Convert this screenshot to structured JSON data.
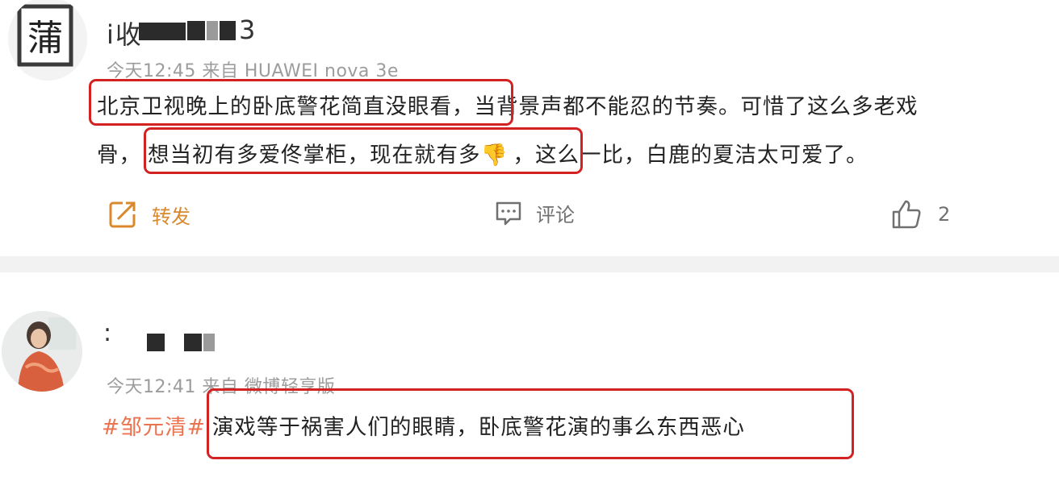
{
  "post1": {
    "avatar_char": "蒲",
    "username_visible": "i收",
    "username_tail": "3",
    "meta": "今天12:45  来自 HUAWEI nova 3e",
    "line1_highlight": "北京卫视晚上的卧底警花简直没眼看",
    "line1_rest": "，当背景声都不能忍的节奏。可惜了这么多老戏",
    "line2_start": "骨，",
    "line2_highlight": "想当初有多爱佟掌柜，现在就有多👎",
    "line2_rest": "，这么一比，白鹿的夏洁太可爱了。",
    "actions": {
      "repost_label": "转发",
      "comment_label": "评论",
      "like_count": "2"
    }
  },
  "post2": {
    "username_visible": ":",
    "meta": "今天12:41  来自 微博轻享版",
    "topic": "#邹元清#",
    "body_highlight": "演戏等于祸害人们的眼睛，卧底警花演的事么东西恶心"
  },
  "colors": {
    "highlight_border": "#d32222",
    "topic": "#eb7350",
    "repost": "#d9892b",
    "meta": "#9c9c9c"
  },
  "icons": [
    "repost-icon",
    "comment-icon",
    "like-icon"
  ]
}
